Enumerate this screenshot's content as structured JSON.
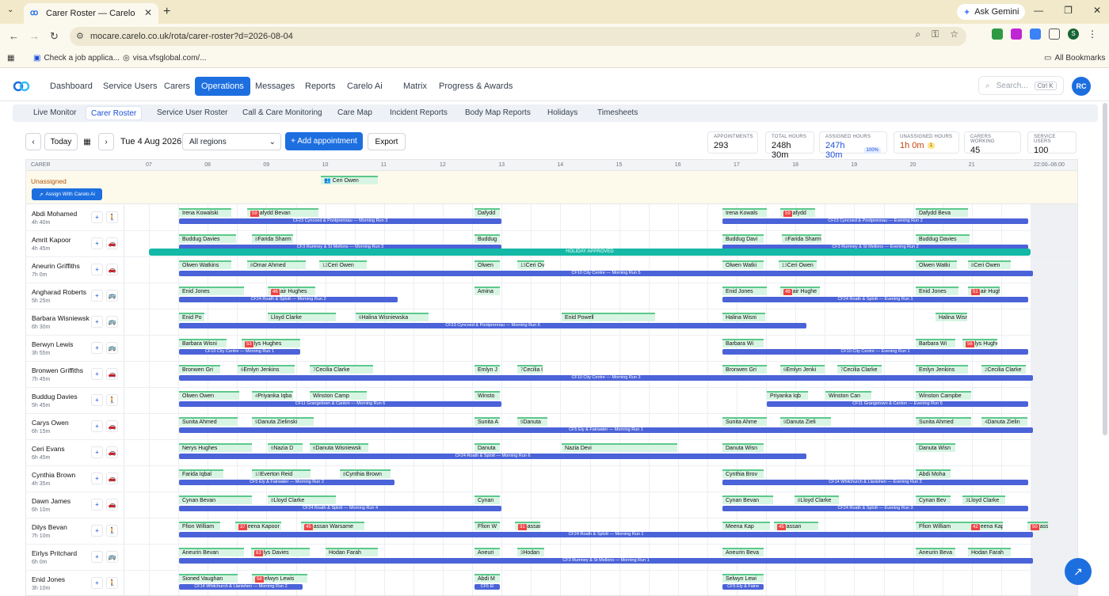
{
  "browser": {
    "tab_title": "Carer Roster — Carelo",
    "url": "mocare.carelo.co.uk/rota/carer-roster?d=2026-08-04",
    "gemini_label": "Ask Gemini",
    "profile_initial": "S",
    "bookmarks": [
      "Check a job applica...",
      "visa.vfsglobal.com/...",
      "All Bookmarks"
    ]
  },
  "nav": {
    "items": [
      "Dashboard",
      "Service Users",
      "Carers",
      "Operations",
      "Messages",
      "Reports",
      "Carelo Ai",
      "Matrix",
      "Progress & Awards"
    ],
    "active": "Operations",
    "search_placeholder": "Search...",
    "search_kbd": "Ctrl K",
    "avatar": "RC"
  },
  "subnav": {
    "items": [
      "Live Monitor",
      "Carer Roster",
      "Service User Roster",
      "Call & Care Monitoring",
      "Care Map",
      "Incident Reports",
      "Body Map Reports",
      "Holidays",
      "Timesheets"
    ],
    "active": "Carer Roster"
  },
  "toolbar": {
    "today": "Today",
    "date": "Tue 4 Aug 2026",
    "region": "All regions",
    "add": "+ Add appointment",
    "export": "Export"
  },
  "stats": [
    {
      "label": "APPOINTMENTS",
      "value": "293"
    },
    {
      "label": "TOTAL HOURS",
      "value": "248h 30m"
    },
    {
      "label": "ASSIGNED HOURS",
      "value": "247h 30m",
      "badge": "100%"
    },
    {
      "label": "UNASSIGNED HOURS",
      "value": "1h 0m",
      "badge": "1"
    },
    {
      "label": "CARERS WORKING",
      "value": "45"
    },
    {
      "label": "SERVICE USERS",
      "value": "100"
    }
  ],
  "roster": {
    "carer_header": "CARER",
    "hours": [
      "07",
      "08",
      "09",
      "10",
      "11",
      "12",
      "13",
      "14",
      "15",
      "16",
      "17",
      "18",
      "19",
      "20",
      "21"
    ],
    "night_label": "22:00–06:00",
    "unassigned_label": "Unassigned",
    "assign_ai": "Assign With Carelo Ai",
    "unassigned_appt": "Ceri Owen",
    "holiday": "HOLIDAY APPROVED",
    "carers": [
      {
        "name": "Abdi Mohamed",
        "hours": "4h 40m",
        "mode": "walk",
        "appts": [
          [
            "Irena Kowalski",
            ""
          ],
          [
            "afydd Bevan",
            "59"
          ],
          [
            "Dafydd",
            ""
          ],
          [
            "Irena Kowals",
            ""
          ],
          [
            "afydd",
            "59"
          ],
          [
            "Dafydd Beva",
            ""
          ]
        ],
        "runs": [
          "CF23 Cyncoed & Pontprennau — Morning Run 3",
          "CF23 Cyncoed & Pontprennau — Evening Run 2"
        ]
      },
      {
        "name": "Amrit Kapoor",
        "hours": "4h 45m",
        "mode": "car",
        "appts": [
          [
            "Buddug Davies",
            ""
          ],
          [
            "Farida Sharm",
            "8"
          ],
          [
            "Buddug",
            ""
          ],
          [
            "Buddug Davi",
            ""
          ],
          [
            "Farida Sharm",
            "8"
          ],
          [
            "Buddug Davies",
            ""
          ]
        ],
        "runs": [
          "CF3 Rumney & St Mellons — Morning Run 3",
          "CF3 Rumney & St Mellons — Evening Run 2"
        ]
      },
      {
        "name": "Aneurin Griffiths",
        "hours": "7h 0m",
        "mode": "car",
        "appts": [
          [
            "Olwen Watkins",
            ""
          ],
          [
            "Omar Ahmed",
            "8"
          ],
          [
            "Ceri Owen",
            "12"
          ],
          [
            "Olwen",
            ""
          ],
          [
            "Ceri Ov",
            "13"
          ],
          [
            "Olwen Watki",
            ""
          ],
          [
            "Ceri Owen",
            "13"
          ],
          [
            "Olwen Watki",
            ""
          ],
          [
            "Ceri Owen",
            "8"
          ]
        ],
        "runs": [
          "CF10 City Centre — Morning Run 5"
        ]
      },
      {
        "name": "Angharad Roberts",
        "hours": "5h 25m",
        "mode": "bus",
        "appts": [
          [
            "Enid Jones",
            ""
          ],
          [
            "air Hughes",
            "46"
          ],
          [
            "Amina",
            ""
          ],
          [
            "Enid Jones",
            ""
          ],
          [
            "air Hughe",
            "46"
          ],
          [
            "Enid Jones",
            ""
          ],
          [
            "air Hughe",
            "51"
          ]
        ],
        "runs": [
          "CF24 Roath & Splott — Morning Run 2",
          "CF24 Roath & Splott — Evening Run 1"
        ]
      },
      {
        "name": "Barbara Wisniewsk",
        "hours": "6h 30m",
        "mode": "bus",
        "appts": [
          [
            "Enid Po",
            ""
          ],
          [
            "Lloyd Clarke",
            ""
          ],
          [
            "Halina Wisniewska",
            "6"
          ],
          [
            "Enid Powell",
            ""
          ],
          [
            "Halina Wisni",
            ""
          ],
          [
            "Halina Wisni",
            ""
          ]
        ],
        "runs": [
          "CF23 Cyncoed & Pontprennau — Morning Run 6"
        ]
      },
      {
        "name": "Berwyn Lewis",
        "hours": "3h 55m",
        "mode": "bus",
        "appts": [
          [
            "Barbara Wisni",
            ""
          ],
          [
            "lys Hughes",
            "53"
          ],
          [
            "Barbara Wi",
            ""
          ],
          [
            "Barbara Wi",
            ""
          ],
          [
            "lys Hughes",
            "56"
          ]
        ],
        "runs": [
          "CF10 City Centre — Morning Run 1",
          "CF10 City Centre — Evening Run 1"
        ]
      },
      {
        "name": "Bronwen Griffiths",
        "hours": "7h 45m",
        "mode": "car",
        "appts": [
          [
            "Bronwen Gri",
            ""
          ],
          [
            "Emlyn Jenkins",
            "6"
          ],
          [
            "Cecilia Clarke",
            "7"
          ],
          [
            "Emlyn J",
            ""
          ],
          [
            "Cecilia C",
            "7"
          ],
          [
            "Bronwen Gri",
            ""
          ],
          [
            "Emlyn Jenki",
            "6"
          ],
          [
            "Cecilia Clarke",
            "7"
          ],
          [
            "Emlyn Jenkins",
            ""
          ],
          [
            "Cecilia Clarke",
            "2"
          ]
        ],
        "runs": [
          "CF10 City Centre — Morning Run 3"
        ]
      },
      {
        "name": "Buddug Davies",
        "hours": "5h 45m",
        "mode": "walk",
        "appts": [
          [
            "Olwen Owen",
            ""
          ],
          [
            "Priyanka Iqba",
            "4"
          ],
          [
            "Winston Camp",
            ""
          ],
          [
            "Winsto",
            ""
          ],
          [
            "Priyanka Iqb",
            ""
          ],
          [
            "Winston Can",
            ""
          ],
          [
            "Winston Campbe",
            ""
          ]
        ],
        "runs": [
          "CF11 Grangetown & Canton — Morning Run 6",
          "CF11 Grangetown & Canton — Evening Run 6"
        ]
      },
      {
        "name": "Carys Owen",
        "hours": "6h 15m",
        "mode": "car",
        "appts": [
          [
            "Sunita Ahmed",
            ""
          ],
          [
            "Danuta Zielinski",
            "9"
          ],
          [
            "Sunita A",
            ""
          ],
          [
            "Danuta",
            "9"
          ],
          [
            "Sunita Ahme",
            ""
          ],
          [
            "Danuta Zieli",
            "9"
          ],
          [
            "Sunita Ahmed",
            ""
          ],
          [
            "Danuta Zielin",
            "4"
          ]
        ],
        "runs": [
          "CF5 Ely & Fairwater — Morning Run 1"
        ]
      },
      {
        "name": "Ceri Evans",
        "hours": "6h 45m",
        "mode": "car",
        "appts": [
          [
            "Nerys Hughes",
            ""
          ],
          [
            "Nazia D",
            "6"
          ],
          [
            "Danuta Wisniewsk",
            "6"
          ],
          [
            "Danuta",
            ""
          ],
          [
            "Nazia Devi",
            ""
          ],
          [
            "Danuta Wisn",
            ""
          ],
          [
            "Danuta Wisn",
            ""
          ]
        ],
        "runs": [
          "CF24 Roath & Splott — Morning Run 6"
        ]
      },
      {
        "name": "Cynthia Brown",
        "hours": "4h 35m",
        "mode": "car",
        "appts": [
          [
            "Farida Iqbal",
            ""
          ],
          [
            "Everton Reid",
            "10"
          ],
          [
            "Cynthia Brown",
            "8"
          ],
          [
            "Cynthia Brov",
            ""
          ],
          [
            "Abdi Moha",
            ""
          ]
        ],
        "runs": [
          "CF5 Ely & Fairwater — Morning Run 2",
          "CF14 Whitchurch & Llanishen — Evening Run 3"
        ]
      },
      {
        "name": "Dawn James",
        "hours": "6h 10m",
        "mode": "car",
        "appts": [
          [
            "Cynan Bevan",
            ""
          ],
          [
            "Lloyd Clarke",
            "8"
          ],
          [
            "Cynan",
            ""
          ],
          [
            "Cynan Bevan",
            ""
          ],
          [
            "Lloyd Clarke",
            "8"
          ],
          [
            "Cynan Bev",
            ""
          ],
          [
            "Lloyd Clarke",
            "3"
          ]
        ],
        "runs": [
          "CF24 Roath & Splott — Morning Run 4",
          "CF24 Roath & Splott — Evening Run 3"
        ]
      },
      {
        "name": "Dilys Bevan",
        "hours": "7h 10m",
        "mode": "walk",
        "appts": [
          [
            "Ffion William",
            ""
          ],
          [
            "eena Kapoor",
            "37"
          ],
          [
            "assan Warsame",
            "45"
          ],
          [
            "Ffion W",
            ""
          ],
          [
            "assan",
            "31"
          ],
          [
            "Meena Kap",
            ""
          ],
          [
            "assan",
            "45"
          ],
          [
            "Ffion William",
            ""
          ],
          [
            "eena Kap",
            "42"
          ],
          [
            "assa",
            "50"
          ]
        ],
        "runs": [
          "CF24 Roath & Splott — Morning Run 1"
        ]
      },
      {
        "name": "Eirlys Pritchard",
        "hours": "6h 0m",
        "mode": "bus",
        "appts": [
          [
            "Aneurin Bevan",
            ""
          ],
          [
            "lys Davies",
            "63"
          ],
          [
            "Hodan Farah",
            ""
          ],
          [
            "Aneuri",
            ""
          ],
          [
            "Hodan",
            "3"
          ],
          [
            "Aneurin Beva",
            ""
          ],
          [
            "Aneurin Beva",
            ""
          ],
          [
            "Hodan Farah",
            ""
          ]
        ],
        "runs": [
          "CF3 Rumney & St Mellons — Morning Run 1"
        ]
      },
      {
        "name": "Enid Jones",
        "hours": "3h 10m",
        "mode": "walk",
        "appts": [
          [
            "Sioned Vaughan",
            ""
          ],
          [
            "elwyn Lewis",
            "58"
          ],
          [
            "Abdi M",
            ""
          ],
          [
            "Selwyn Lewi",
            ""
          ]
        ],
        "runs": [
          "CF14 Whitchurch & Llanishen — Morning Run 2",
          "CF5 El",
          "CF5 Ely & Fairw"
        ]
      }
    ]
  }
}
